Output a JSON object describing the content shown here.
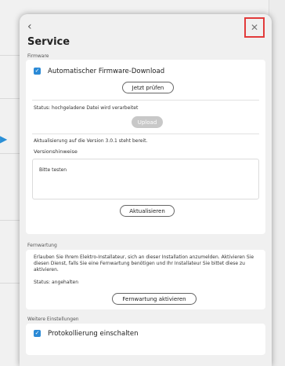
{
  "modal": {
    "back_icon": "chevron-left-icon",
    "close_icon": "close-icon",
    "title": "Service"
  },
  "firmware": {
    "section_label": "Firmware",
    "auto_download_label": "Automatischer Firmware-Download",
    "auto_download_checked": true,
    "check_now_button": "Jetzt prüfen",
    "status_text": "Status: hochgeladene Datei wird verarbeitet",
    "upload_button": "Upload",
    "update_text": "Aktualisierung auf die Version 3.0.1 steht bereit.",
    "release_notes_label": "Versionshinweise",
    "release_notes_value": "Bitte testen",
    "update_button": "Aktualisieren"
  },
  "remote": {
    "section_label": "Fernwartung",
    "description": "Erlauben Sie Ihrem Elektro-Installateur, sich an dieser Installation anzumelden. Aktivieren Sie diesen Dienst, falls Sie eine Fernwartung benötigen und Ihr Installateur Sie bittet diese zu aktivieren.",
    "status_text": "Status: angehalten",
    "activate_button": "Fernwartung aktivieren"
  },
  "further": {
    "section_label": "Weitere Einstellungen",
    "logging_label": "Protokollierung einschalten",
    "logging_checked": true
  },
  "colors": {
    "accent": "#2b8ad6",
    "highlight_border": "#e23b3b"
  }
}
